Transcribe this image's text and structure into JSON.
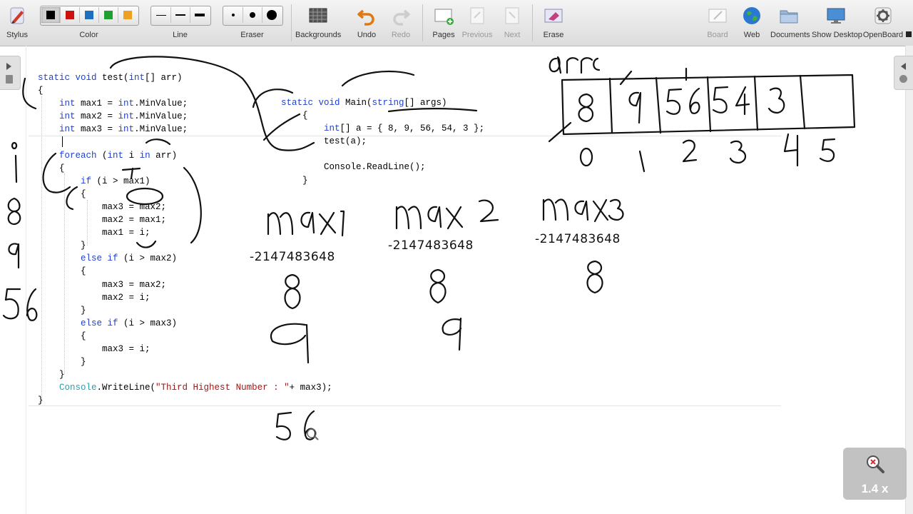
{
  "toolbar": {
    "stylus": "Stylus",
    "color": "Color",
    "line": "Line",
    "eraser": "Eraser",
    "backgrounds": "Backgrounds",
    "undo": "Undo",
    "redo": "Redo",
    "pages": "Pages",
    "previous": "Previous",
    "next": "Next",
    "erase": "Erase",
    "board": "Board",
    "web": "Web",
    "documents": "Documents",
    "show_desktop": "Show Desktop",
    "openboard": "OpenBoard",
    "colors": [
      "#000000",
      "#cc1111",
      "#1f6fc0",
      "#20a030",
      "#f0a020"
    ],
    "selected_color": "#000000",
    "line_widths": [
      "thin",
      "medium",
      "thick"
    ],
    "eraser_sizes": [
      "small",
      "medium",
      "large"
    ]
  },
  "code_left": {
    "sig_kw1": "static void ",
    "sig_name": "test(",
    "sig_kw2": "int",
    "sig_rest": "[] arr)",
    "brace_open": "{",
    "decl": [
      {
        "kw": "int",
        "name": " max1 = ",
        "kw2": "int",
        "rest": ".MinValue;"
      },
      {
        "kw": "int",
        "name": " max2 = ",
        "kw2": "int",
        "rest": ".MinValue;"
      },
      {
        "kw": "int",
        "name": " max3 = ",
        "kw2": "int",
        "rest": ".MinValue;"
      }
    ],
    "foreach_kw": "foreach",
    "foreach_rest1": " (",
    "foreach_int": "int",
    "foreach_rest2": " i ",
    "foreach_in": "in",
    "foreach_rest3": " arr)",
    "brace_foreach": "{",
    "if1_kw": "if",
    "if1_rest": " (i > max1)",
    "b1": "{",
    "l1": "max3 = max2;",
    "l2": "max2 = max1;",
    "l3": "max1 = i;",
    "b1c": "}",
    "elif2_kw": "else if",
    "elif2_rest": " (i > max2)",
    "b2": "{",
    "l4": "max3 = max2;",
    "l5": "max2 = i;",
    "b2c": "}",
    "elif3_kw": "else if",
    "elif3_rest": " (i > max3)",
    "b3": "{",
    "l6": "max3 = i;",
    "b3c": "}",
    "brace_foreach_close": "}",
    "console": "Console",
    "writeline": ".WriteLine(",
    "str": "\"Third Highest Number : \"",
    "writeline_rest": "+ max3);",
    "brace_close": "}"
  },
  "code_main": {
    "sig_kw": "static void ",
    "sig_name": "Main(",
    "sig_kw2": "string",
    "sig_rest": "[] args)",
    "brace_open": "{",
    "arr_kw": "int",
    "arr_rest": "[] a = { 8, 9, 56, 54, 3 };",
    "call": "test(a);",
    "readline": "Console.ReadLine();",
    "brace_close": "}"
  },
  "typed_values": {
    "max1_init": "-2147483648",
    "max2_init": "-2147483648",
    "max3_init": "-2147483648"
  },
  "zoom": {
    "label": "1.4 x"
  }
}
